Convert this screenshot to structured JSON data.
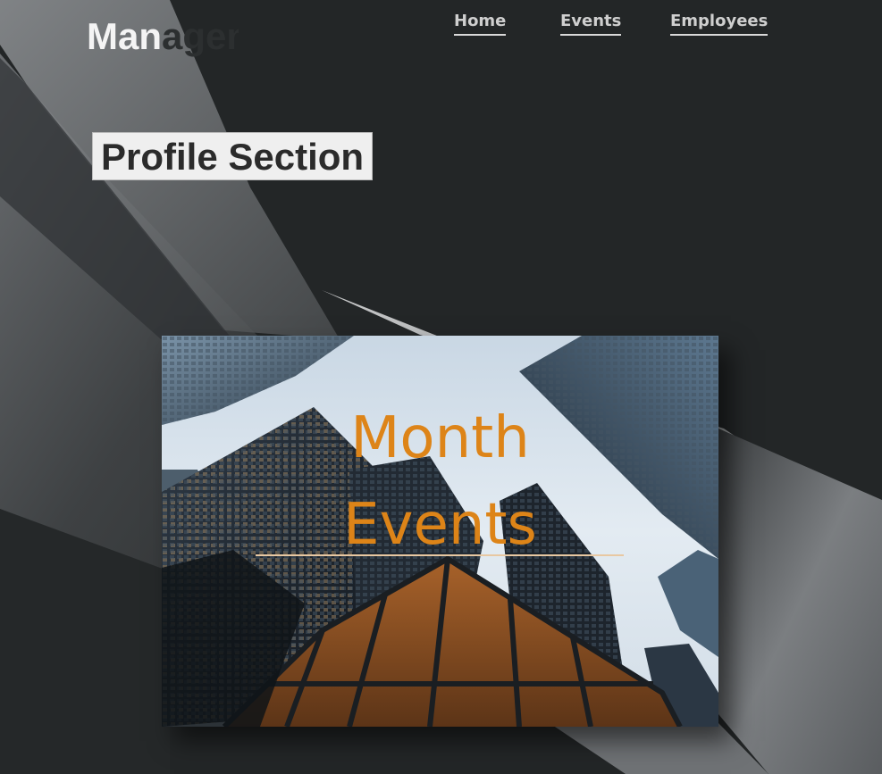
{
  "header": {
    "brand_visible": "Man",
    "brand_faded": "agement"
  },
  "nav": {
    "items": [
      {
        "label": "Home"
      },
      {
        "label": "Events"
      },
      {
        "label": "Employees"
      }
    ]
  },
  "main": {
    "section_title": "Profile Section",
    "card": {
      "title_line1": "Month",
      "title_line2": "Events",
      "title_color": "#dd8418"
    }
  },
  "colors": {
    "background": "#232627",
    "accent": "#dd8418",
    "nav_text": "#cfcfcf"
  }
}
